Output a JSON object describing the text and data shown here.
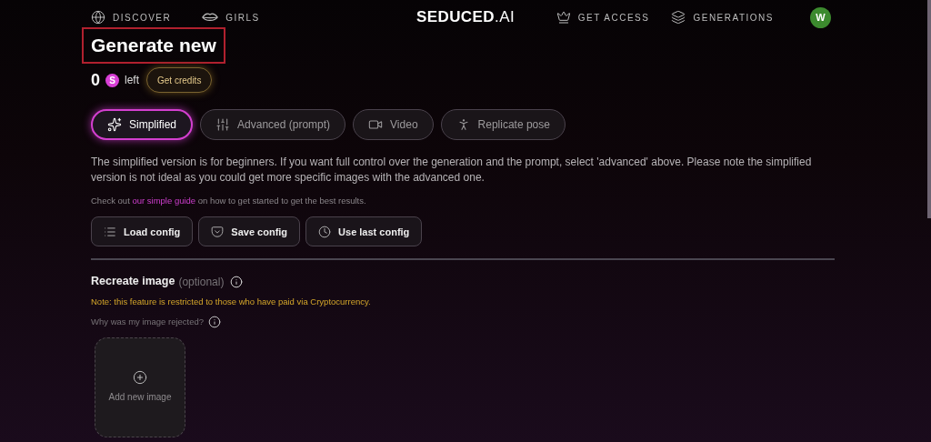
{
  "nav": {
    "left": [
      {
        "label": "DISCOVER"
      },
      {
        "label": "GIRLS"
      }
    ],
    "logo": "**SEDUCED**.AI",
    "right": [
      {
        "label": "GET ACCESS"
      },
      {
        "label": "GENERATIONS"
      }
    ],
    "avatar": "W"
  },
  "title": "Generate new",
  "credits": {
    "count": "0",
    "coin": "S",
    "suffix": "left",
    "button": "Get credits"
  },
  "tabs": [
    {
      "label": "Simplified",
      "selected": true
    },
    {
      "label": "Advanced (prompt)",
      "selected": false
    },
    {
      "label": "Video",
      "selected": false
    },
    {
      "label": "Replicate pose",
      "selected": false
    }
  ],
  "description": "The simplified version is for beginners. If you want full control over the generation and the prompt, select 'advanced' above. Please note the simplified version is not ideal as you could get more specific images with the advanced one.",
  "guide": {
    "before": "Check out ",
    "link": "our simple guide",
    "after": " on how to get started to get the best results."
  },
  "config_buttons": [
    {
      "label": "Load config"
    },
    {
      "label": "Save config"
    },
    {
      "label": "Use last config"
    }
  ],
  "recreate": {
    "title": "Recreate image",
    "optional": "(optional)",
    "note": "Note: this feature is restricted to those who have paid via Cryptocurrency.",
    "rejected": "Why was my image rejected?",
    "upload": "Add new image"
  }
}
